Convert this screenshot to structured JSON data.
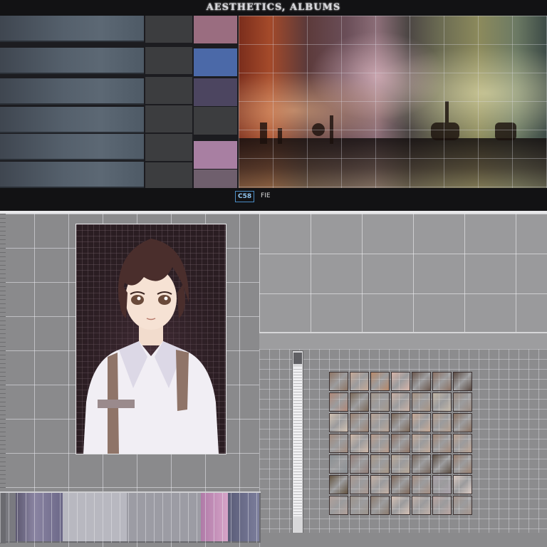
{
  "header": {
    "title": "AESTHETICS, ALBUMS"
  },
  "top_list": {
    "rows": [
      "",
      "",
      "",
      "",
      "",
      ""
    ]
  },
  "swatches": [
    "#9a6d80",
    "#4b69a8",
    "#4c4560",
    "#3c3d3f",
    "#a87fa2",
    "#6f5f6d"
  ],
  "footer": {
    "badge": "C58",
    "label": "FIE"
  },
  "thumbnails": [
    "#8f7666",
    "#c4a896",
    "#b8896a",
    "#d6b4a8",
    "#6d5a50",
    "#8c7264",
    "#5c4c44",
    "#b08878",
    "#7c6a5a",
    "#a4988c",
    "#c8b0a4",
    "#a89484",
    "#c2b6a6",
    "#9a8a80",
    "#d0c0b0",
    "#9c8474",
    "#b8a496",
    "#7c6858",
    "#c6a894",
    "#b29c8c",
    "#8a7262",
    "#a28b7e",
    "#cfb8a8",
    "#b89c8c",
    "#907668",
    "#c0a898",
    "#a28878",
    "#b8a090",
    "#8a9094",
    "#94807a",
    "#a89888",
    "#b8a898",
    "#7a6a60",
    "#5e5044",
    "#9a8070",
    "#645440",
    "#a89890",
    "#c4b0a4",
    "#806a5c",
    "#a48e82",
    "#a8a0a8",
    "#d8c8c0",
    "#b0a09a",
    "#9c948c",
    "#8c7c70",
    "#d4c0b4",
    "#c0b0a8",
    "#b8a4a0",
    "#a4948c"
  ],
  "colors": {
    "accent": "#4a8cc4",
    "panel_dark": "#121214",
    "workspace": "#8a8a8c"
  }
}
